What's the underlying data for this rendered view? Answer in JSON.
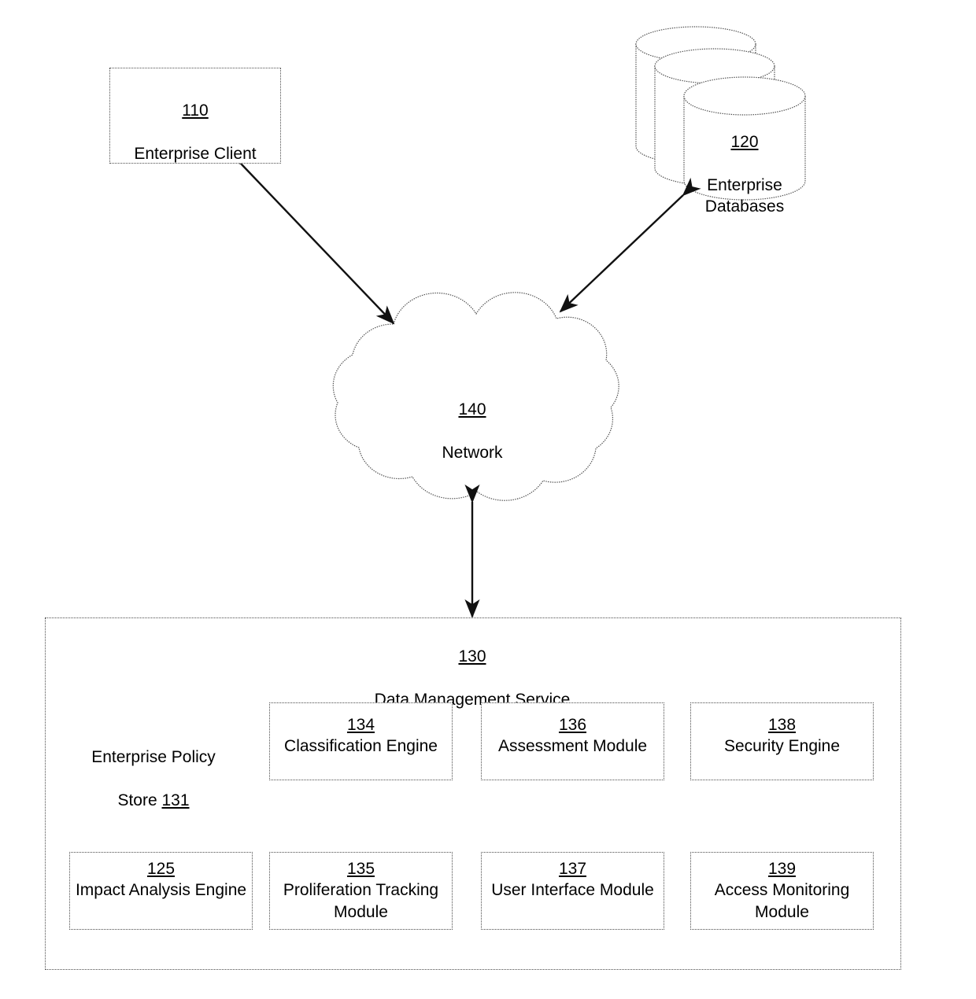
{
  "figure": {
    "type": "patent-system-diagram",
    "stroke_color": "#4d4d4d",
    "arrow_color": "#111111",
    "background": "#ffffff"
  },
  "nodes": {
    "enterprise_client": {
      "ref": "110",
      "name": "Enterprise Client",
      "shape": "rectangle"
    },
    "enterprise_databases": {
      "ref": "120",
      "name": "Enterprise\nDatabases",
      "shape": "stacked-cylinders"
    },
    "network": {
      "ref": "140",
      "name": "Network",
      "shape": "cloud"
    },
    "data_management_service": {
      "ref": "130",
      "name": "Data Management Service",
      "shape": "container"
    },
    "enterprise_policy_store": {
      "ref": "131",
      "name": "Enterprise Policy Store",
      "name_line1": "Enterprise Policy",
      "name_line2": "Store ",
      "shape": "cylinder"
    }
  },
  "modules": {
    "row1": [
      {
        "ref": "134",
        "name": "Classification Engine"
      },
      {
        "ref": "136",
        "name": "Assessment Module"
      },
      {
        "ref": "138",
        "name": "Security Engine"
      }
    ],
    "row2": [
      {
        "ref": "125",
        "name": "Impact Analysis\nEngine"
      },
      {
        "ref": "135",
        "name": "Proliferation\nTracking Module"
      },
      {
        "ref": "137",
        "name": "User Interface\nModule"
      },
      {
        "ref": "139",
        "name": "Access Monitoring\nModule"
      }
    ]
  },
  "connections": [
    {
      "from": "enterprise_client",
      "to": "network",
      "style": "double-arrow"
    },
    {
      "from": "enterprise_databases",
      "to": "network",
      "style": "double-arrow"
    },
    {
      "from": "network",
      "to": "data_management_service",
      "style": "double-arrow"
    }
  ]
}
